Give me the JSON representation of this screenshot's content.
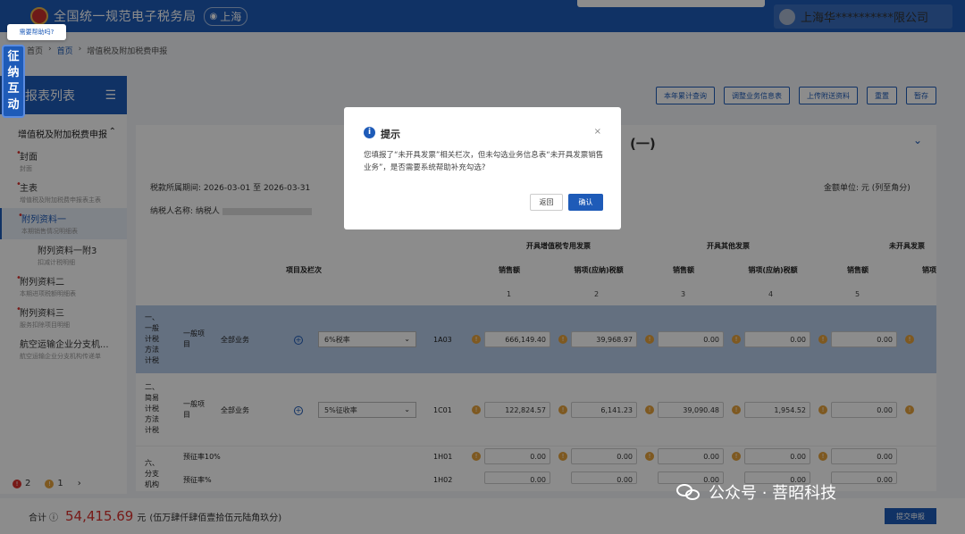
{
  "header": {
    "site_title": "全国统一规范电子税务局",
    "location": "上海",
    "company": "上海华**********限公司"
  },
  "help_bubble": "需要帮助吗?",
  "side_badge": [
    "征",
    "纳",
    "互",
    "动"
  ],
  "breadcrumb": {
    "first": "首页",
    "home": "首页",
    "current": "增值税及附加税费申报"
  },
  "sidebar": {
    "title": "报表列表",
    "group": "增值税及附加税费申报",
    "items": [
      {
        "label": "封面",
        "sub": "封面"
      },
      {
        "label": "主表",
        "sub": "增值税及附加税费申报表主表"
      },
      {
        "label": "附列资料一",
        "sub": "本期销售情况明细表"
      },
      {
        "label": "附列资料一附3",
        "sub": "扣减计税明细"
      },
      {
        "label": "附列资料二",
        "sub": "本期进项税额明细表"
      },
      {
        "label": "附列资料三",
        "sub": "服务扣除项目明细"
      },
      {
        "label": "航空运输企业分支机...",
        "sub": "航空运输企业分支机构传递单"
      }
    ],
    "bottom": {
      "errors": "2",
      "warnings": "1",
      "next": "›"
    }
  },
  "toolbar": [
    "本年累计查询",
    "调整业务信息表",
    "上传附送资料",
    "重置",
    "暂存"
  ],
  "form": {
    "title_suffix": "(一)",
    "period_label": "税款所属期间:",
    "period_value": "2026-03-01 至 2026-03-31",
    "taxpayer_label": "纳税人名称:",
    "taxpayer_value": "纳税人",
    "unit": "金额单位: 元 (列至角分)"
  },
  "table": {
    "item_header": "项目及栏次",
    "groups": [
      "开具增值税专用发票",
      "开具其他发票",
      "未开具发票"
    ],
    "cols": [
      "销售额",
      "销项(应纳)税额",
      "销售额",
      "销项(应纳)税额",
      "销售额",
      "销项"
    ],
    "col_nums": [
      "1",
      "2",
      "3",
      "4",
      "5"
    ],
    "rows": [
      {
        "section": "一、一般计税方法计税",
        "type": "一般项目",
        "biz": "全部业务",
        "rate": "6%税率",
        "code": "1A03",
        "values": [
          "666,149.40",
          "39,968.97",
          "0.00",
          "0.00",
          "0.00"
        ]
      },
      {
        "section": "二、简易计税方法计税",
        "type": "一般项目",
        "biz": "全部业务",
        "rate": "5%征收率",
        "code": "1C01",
        "values": [
          "122,824.57",
          "6,141.23",
          "39,090.48",
          "1,954.52",
          "0.00"
        ]
      }
    ],
    "prepay_section": "六、分支机构",
    "prepay_rows": [
      {
        "label": "预征率10%",
        "code": "1H01",
        "values": [
          "0.00",
          "0.00",
          "0.00",
          "0.00",
          "0.00"
        ]
      },
      {
        "label": "预征率%",
        "code": "1H02",
        "values": [
          "0.00",
          "0.00",
          "0.00",
          "0.00",
          "0.00"
        ]
      }
    ]
  },
  "footer": {
    "total_label": "合计",
    "total_value": "54,415.69",
    "currency": "元",
    "total_words": "(伍万肆仟肆佰壹拾伍元陆角玖分)",
    "submit": "提交申报"
  },
  "dialog": {
    "title": "提示",
    "message": "您填报了“未开具发票”相关栏次，但未勾选业务信息表“未开具发票销售业务”，是否需要系统帮助补充勾选?",
    "cancel": "返回",
    "confirm": "确认",
    "close": "×"
  },
  "watermark": "公众号 · 菩昭科技",
  "colors": {
    "primary": "#1e5bb8",
    "danger": "#d9302c",
    "warning": "#e6a23c",
    "row_highlight": "#b7ccea"
  }
}
